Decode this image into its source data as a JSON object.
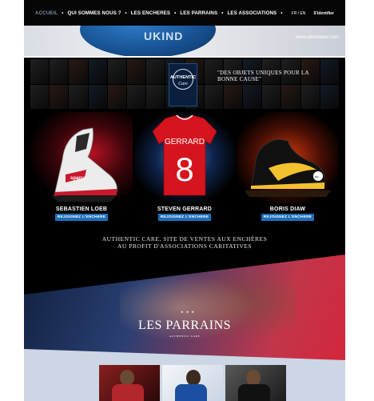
{
  "nav": {
    "items": [
      "ACCUEIL",
      "•",
      "QUI SOMMES NOUS ?",
      "•",
      "LES ENCHERES",
      "•",
      "LES PARRAINS",
      "•",
      "LES ASSOCIATIONS",
      "•"
    ],
    "lang": "FR / EN",
    "login": "S'identifier"
  },
  "banner": {
    "jersey_text": "UKIND",
    "url": "www.ukindwear.com"
  },
  "brand": {
    "logo_line1": "AUTHENTIC",
    "logo_line2": "Care",
    "slogan": "\"DES OBJETS UNIQUES POUR LA BONNE CAUSE\""
  },
  "products": [
    {
      "name": "SEBASTIEN LOEB",
      "button": "REJOIGNEZ L'ENCHERE",
      "image": "racing-boot"
    },
    {
      "name": "STEVEN GERRARD",
      "button": "REJOIGNEZ L'ENCHERE",
      "image": "football-jersey",
      "jersey_name": "GERRARD",
      "jersey_number": "8"
    },
    {
      "name": "BORIS DIAW",
      "button": "REJOIGNEZ L'ENCHERE",
      "image": "basketball-sneaker"
    }
  ],
  "tagline": {
    "line1": "AUTHENTIC CARE, SITE DE VENTES AUX ENCHÈRES",
    "line2": "AU PROFIT D'ASSOCIATIONS CARITATIVES"
  },
  "parrains": {
    "title": "LES PARRAINS",
    "subtitle": "AUTHENTIC CARE",
    "stars": "★ ★ ★"
  },
  "colors": {
    "button_blue": "#1f6fb8",
    "page_bg": "#000000"
  }
}
